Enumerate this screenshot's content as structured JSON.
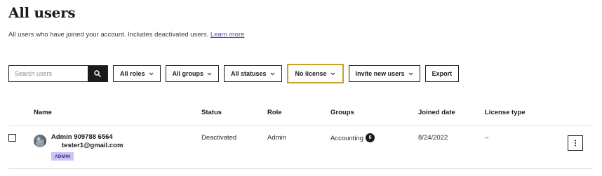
{
  "page": {
    "title": "All users",
    "subtitle": "All users who have joined your account. Includes deactivated users.",
    "learn_more": "Learn more"
  },
  "toolbar": {
    "search_placeholder": "Search users",
    "filters": {
      "roles": "All roles",
      "groups": "All groups",
      "statuses": "All statuses",
      "license": "No license",
      "invite": "Invite new users",
      "export": "Export"
    }
  },
  "table": {
    "columns": {
      "name": "Name",
      "status": "Status",
      "role": "Role",
      "groups": "Groups",
      "joined": "Joined date",
      "license": "License type"
    },
    "rows": [
      {
        "name": "Admin 909788 6564",
        "email": "tester1@gmail.com",
        "badge": "ADMIN",
        "status": "Deactivated",
        "role": "Admin",
        "group": "Accounting",
        "group_count": "6",
        "joined": "8/24/2022",
        "license": "–"
      }
    ]
  },
  "colors": {
    "highlight_border": "#c9a227",
    "link": "#5b3cc4",
    "badge_bg": "#cfc2f5"
  }
}
